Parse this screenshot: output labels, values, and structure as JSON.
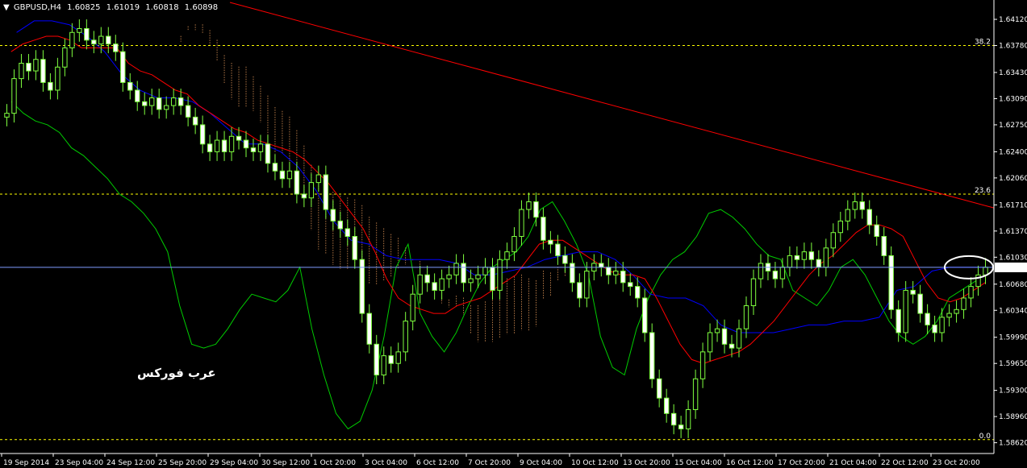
{
  "header": {
    "symbol": "GBPUSD,H4",
    "open": "1.60825",
    "high": "1.61019",
    "low": "1.60818",
    "close": "1.60898"
  },
  "watermark": "عرب فوركس",
  "chart_data": {
    "type": "candlestick",
    "title": "GBPUSD,H4",
    "ylim": [
      1.5848,
      1.6434
    ],
    "current_price": 1.60898,
    "y_ticks": [
      "1.64120",
      "1.63780",
      "1.63430",
      "1.63090",
      "1.62750",
      "1.62400",
      "1.62060",
      "1.61710",
      "1.61370",
      "1.61030",
      "1.60680",
      "1.60340",
      "1.59990",
      "1.59650",
      "1.59300",
      "1.58960",
      "1.58620"
    ],
    "x_ticks": [
      "19 Sep 2014",
      "23 Sep 04:00",
      "24 Sep 12:00",
      "25 Sep 20:00",
      "29 Sep 04:00",
      "30 Sep 12:00",
      "1 Oct 20:00",
      "3 Oct 04:00",
      "6 Oct 12:00",
      "7 Oct 20:00",
      "9 Oct 04:00",
      "10 Oct 12:00",
      "13 Oct 20:00",
      "15 Oct 04:00",
      "16 Oct 12:00",
      "17 Oct 20:00",
      "21 Oct 04:00",
      "22 Oct 12:00",
      "23 Oct 20:00"
    ],
    "fib_levels": [
      {
        "label": "38.2",
        "price": 1.6378
      },
      {
        "label": "23.6",
        "price": 1.6185
      },
      {
        "label": "0.0",
        "price": 1.5866
      }
    ],
    "trendline": {
      "from_price": 1.6434,
      "to_price": 1.6167
    },
    "colors": {
      "background": "#000000",
      "candle_up": "#000000",
      "candle_down": "#ffffff",
      "candle_edge": "#7fff3f",
      "chikou": "#00cc00",
      "kijun": "#0000ff",
      "tenkan": "#ff0000",
      "cloud": "#f4a460",
      "trendline": "#ff0000",
      "fib": "#ffff00",
      "price_line": "#7f9cff",
      "axis": "#ffffff"
    },
    "closes": [
      1.629,
      1.6335,
      1.6355,
      1.6345,
      1.636,
      1.633,
      1.632,
      1.635,
      1.6375,
      1.6395,
      1.64,
      1.6385,
      1.638,
      1.639,
      1.638,
      1.637,
      1.633,
      1.632,
      1.6305,
      1.63,
      1.631,
      1.6295,
      1.63,
      1.631,
      1.63,
      1.6285,
      1.6275,
      1.625,
      1.624,
      1.6255,
      1.624,
      1.626,
      1.6255,
      1.6245,
      1.624,
      1.625,
      1.6225,
      1.6215,
      1.6205,
      1.6215,
      1.6185,
      1.618,
      1.62,
      1.621,
      1.6165,
      1.615,
      1.614,
      1.613,
      1.61,
      1.603,
      1.599,
      1.595,
      1.5975,
      1.5965,
      1.598,
      1.602,
      1.6055,
      1.608,
      1.607,
      1.606,
      1.6075,
      1.608,
      1.6095,
      1.607,
      1.6075,
      1.608,
      1.609,
      1.606,
      1.61,
      1.611,
      1.613,
      1.6165,
      1.6175,
      1.6155,
      1.6125,
      1.612,
      1.6105,
      1.6095,
      1.607,
      1.605,
      1.6085,
      1.6095,
      1.609,
      1.608,
      1.6085,
      1.607,
      1.6065,
      1.605,
      1.6005,
      1.5945,
      1.592,
      1.59,
      1.5885,
      1.588,
      1.5905,
      1.5945,
      1.598,
      1.6005,
      1.601,
      1.599,
      1.5985,
      1.601,
      1.604,
      1.6075,
      1.6095,
      1.6085,
      1.6075,
      1.609,
      1.6105,
      1.61,
      1.611,
      1.61,
      1.609,
      1.6115,
      1.6135,
      1.615,
      1.6165,
      1.6175,
      1.6165,
      1.6145,
      1.613,
      1.6105,
      1.6035,
      1.6005,
      1.606,
      1.6055,
      1.603,
      1.6015,
      1.6005,
      1.6025,
      1.603,
      1.6035,
      1.605,
      1.6065,
      1.608,
      1.609
    ],
    "series": [
      {
        "name": "Tenkan-sen",
        "values": [
          1.637,
          1.638,
          1.6385,
          1.639,
          1.639,
          1.6385,
          1.6375,
          1.6375,
          1.6375,
          1.6375,
          1.6355,
          1.6345,
          1.634,
          1.633,
          1.632,
          1.6315,
          1.63,
          1.629,
          1.628,
          1.627,
          1.6265,
          1.6255,
          1.625,
          1.6245,
          1.624,
          1.623,
          1.6215,
          1.62,
          1.618,
          1.616,
          1.614,
          1.611,
          1.6075,
          1.605,
          1.604,
          1.6035,
          1.603,
          1.603,
          1.604,
          1.6045,
          1.605,
          1.606,
          1.607,
          1.608,
          1.61,
          1.612,
          1.6125,
          1.6125,
          1.6115,
          1.6105,
          1.6095,
          1.6085,
          1.608,
          1.608,
          1.6075,
          1.605,
          1.602,
          1.599,
          1.597,
          1.5965,
          1.597,
          1.5975,
          1.598,
          1.599,
          1.6005,
          1.602,
          1.604,
          1.606,
          1.608,
          1.6095,
          1.6105,
          1.612,
          1.6135,
          1.6145,
          1.6145,
          1.614,
          1.613,
          1.61,
          1.607,
          1.605,
          1.6045,
          1.605,
          1.606,
          1.607
        ]
      },
      {
        "name": "Kijun-sen",
        "values": [
          1.6395,
          1.641,
          1.641,
          1.6405,
          1.639,
          1.637,
          1.634,
          1.632,
          1.631,
          1.631,
          1.6305,
          1.629,
          1.627,
          1.625,
          1.625,
          1.624,
          1.622,
          1.619,
          1.615,
          1.6125,
          1.612,
          1.6105,
          1.61,
          1.61,
          1.61,
          1.6095,
          1.608,
          1.608,
          1.6085,
          1.609,
          1.61,
          1.6105,
          1.611,
          1.611,
          1.61,
          1.608,
          1.6055,
          1.605,
          1.605,
          1.604,
          1.6015,
          1.6005,
          1.6005,
          1.6005,
          1.601,
          1.6015,
          1.6015,
          1.602,
          1.602,
          1.6025,
          1.606,
          1.6065,
          1.6085,
          1.609,
          1.609,
          1.609
        ]
      },
      {
        "name": "Chikou Span",
        "values": [
          1.6305,
          1.629,
          1.628,
          1.6275,
          1.6265,
          1.6245,
          1.6235,
          1.622,
          1.6205,
          1.6185,
          1.6175,
          1.616,
          1.614,
          1.611,
          1.604,
          1.599,
          1.5985,
          1.599,
          1.601,
          1.6035,
          1.6055,
          1.605,
          1.6045,
          1.606,
          1.609,
          1.601,
          1.595,
          1.59,
          1.588,
          1.589,
          1.593,
          1.6,
          1.609,
          1.612,
          1.603,
          1.6,
          1.598,
          1.6005,
          1.604,
          1.607,
          1.609,
          1.61,
          1.611,
          1.613,
          1.6165,
          1.6175,
          1.615,
          1.612,
          1.608,
          1.6,
          1.596,
          1.595,
          1.601,
          1.605,
          1.608,
          1.61,
          1.611,
          1.613,
          1.616,
          1.6165,
          1.6155,
          1.614,
          1.612,
          1.6105,
          1.61,
          1.606,
          1.605,
          1.604,
          1.606,
          1.609,
          1.61,
          1.608,
          1.605,
          1.602,
          1.6,
          1.599,
          1.6,
          1.602,
          1.605,
          1.606,
          1.607,
          1.608
        ]
      }
    ]
  }
}
